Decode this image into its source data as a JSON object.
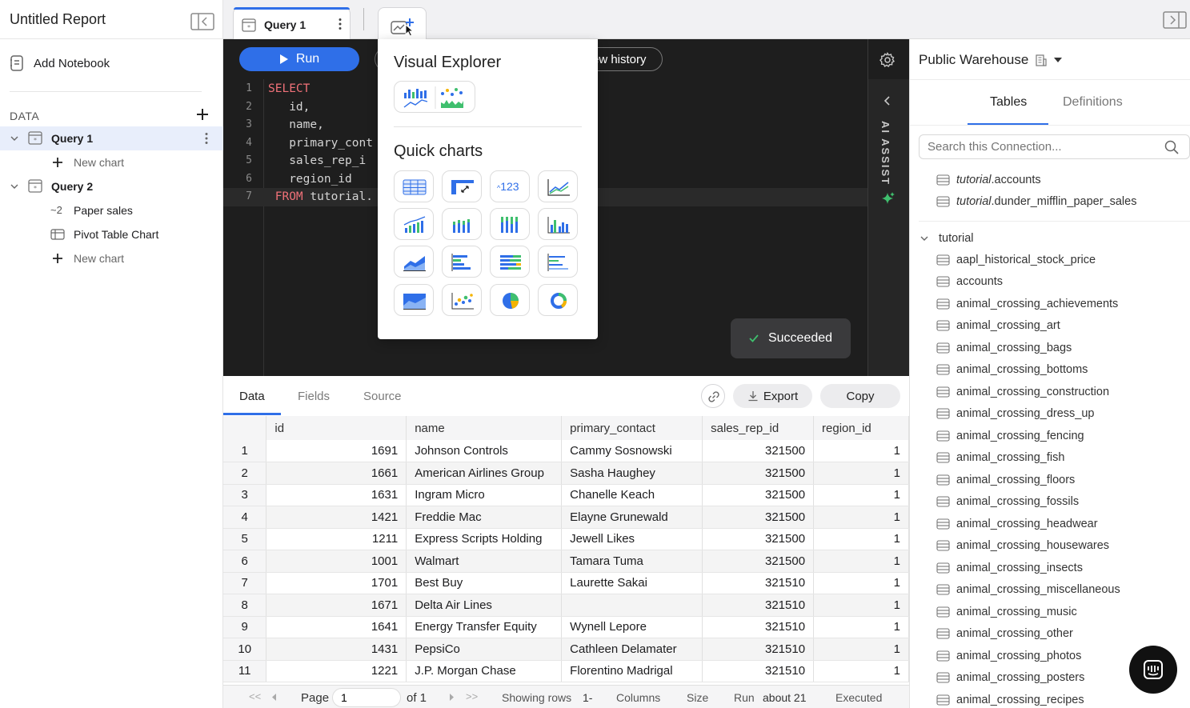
{
  "report": {
    "title": "Untitled Report",
    "add_notebook": "Add Notebook",
    "data_label": "DATA"
  },
  "tree": {
    "query1": {
      "label": "Query 1",
      "new_chart": "New chart"
    },
    "query2": {
      "label": "Query 2",
      "charts": [
        "Paper sales",
        "Pivot Table Chart"
      ],
      "new_chart": "New chart"
    }
  },
  "tabs": {
    "active": "Query 1"
  },
  "editor": {
    "run_label": "Run",
    "history_label": "ew history",
    "lines": [
      {
        "n": "1",
        "text": "SELECT"
      },
      {
        "n": "2",
        "text": "   id,"
      },
      {
        "n": "3",
        "text": "   name,"
      },
      {
        "n": "4",
        "text": "   primary_cont"
      },
      {
        "n": "5",
        "text": "   sales_rep_i"
      },
      {
        "n": "6",
        "text": "   region_id"
      },
      {
        "n": "7",
        "text": " FROM tutorial."
      }
    ],
    "ai_assist": "AI ASSIST",
    "status": "Succeeded"
  },
  "popup": {
    "visual_explorer": "Visual Explorer",
    "quick_charts": "Quick charts",
    "metric_value": "123"
  },
  "results": {
    "tabs": [
      "Data",
      "Fields",
      "Source"
    ],
    "export_label": "Export",
    "copy_label": "Copy",
    "columns": [
      "id",
      "name",
      "primary_contact",
      "sales_rep_id",
      "region_id"
    ],
    "rows": [
      [
        "1",
        "1691",
        "Johnson Controls",
        "Cammy Sosnowski",
        "321500",
        "1"
      ],
      [
        "2",
        "1661",
        "American Airlines Group",
        "Sasha Haughey",
        "321500",
        "1"
      ],
      [
        "3",
        "1631",
        "Ingram Micro",
        "Chanelle Keach",
        "321500",
        "1"
      ],
      [
        "4",
        "1421",
        "Freddie Mac",
        "Elayne Grunewald",
        "321500",
        "1"
      ],
      [
        "5",
        "1211",
        "Express Scripts Holding",
        "Jewell Likes",
        "321500",
        "1"
      ],
      [
        "6",
        "1001",
        "Walmart",
        "Tamara Tuma",
        "321500",
        "1"
      ],
      [
        "7",
        "1701",
        "Best Buy",
        "Laurette Sakai",
        "321510",
        "1"
      ],
      [
        "8",
        "1671",
        "Delta Air Lines",
        "",
        "321510",
        "1"
      ],
      [
        "9",
        "1641",
        "Energy Transfer Equity",
        "Wynell Lepore",
        "321510",
        "1"
      ],
      [
        "10",
        "1431",
        "PepsiCo",
        "Cathleen Delamater",
        "321510",
        "1"
      ],
      [
        "11",
        "1221",
        "J.P. Morgan Chase",
        "Florentino Madrigal",
        "321510",
        "1"
      ]
    ],
    "footer": {
      "page_label": "Page",
      "page_value": "1",
      "of_label": "of 1",
      "showing": "Showing rows",
      "rows_value": "1-",
      "columns": "Columns",
      "size": "Size",
      "run": "Run",
      "run_value": "about 21",
      "executed": "Executed"
    }
  },
  "warehouse": {
    "name": "Public Warehouse",
    "tabs": [
      "Tables",
      "Definitions"
    ],
    "search_placeholder": "Search this Connection...",
    "pinned": [
      {
        "schema": "tutorial",
        "name": ".accounts"
      },
      {
        "schema": "tutorial",
        "name": ".dunder_mifflin_paper_sales"
      }
    ],
    "schema": "tutorial",
    "tables": [
      "aapl_historical_stock_price",
      "accounts",
      "animal_crossing_achievements",
      "animal_crossing_art",
      "animal_crossing_bags",
      "animal_crossing_bottoms",
      "animal_crossing_construction",
      "animal_crossing_dress_up",
      "animal_crossing_fencing",
      "animal_crossing_fish",
      "animal_crossing_floors",
      "animal_crossing_fossils",
      "animal_crossing_headwear",
      "animal_crossing_housewares",
      "animal_crossing_insects",
      "animal_crossing_miscellaneous",
      "animal_crossing_music",
      "animal_crossing_other",
      "animal_crossing_photos",
      "animal_crossing_posters",
      "animal_crossing_recipes"
    ]
  },
  "colors": {
    "accent": "#2f6fe8",
    "success": "#3fbf6e",
    "keyword": "#f07178"
  }
}
